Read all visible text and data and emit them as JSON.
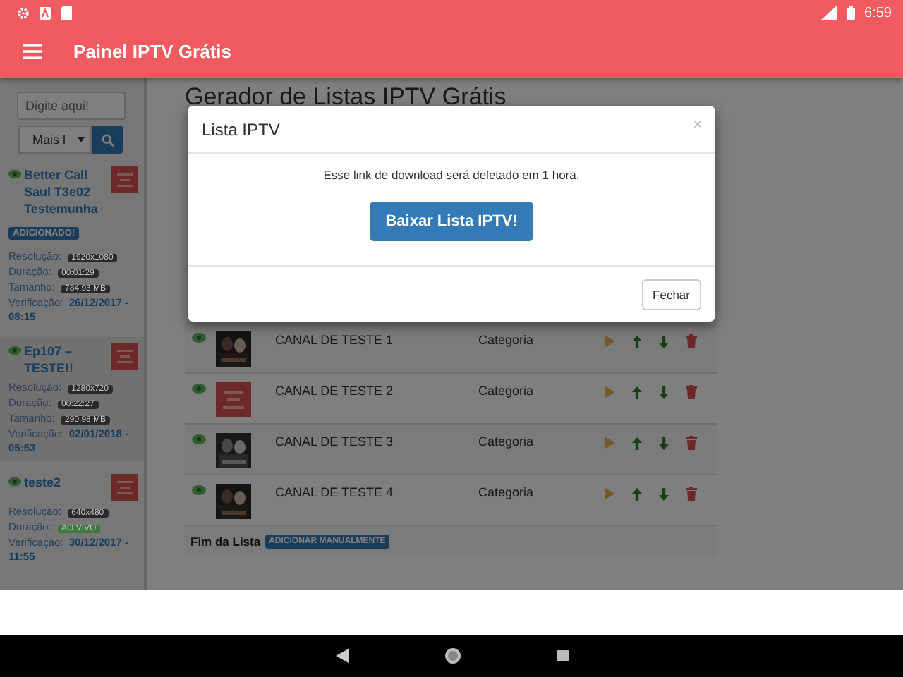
{
  "status_bar": {
    "time": "6:59"
  },
  "app_bar": {
    "title": "Painel IPTV Grátis"
  },
  "sidebar": {
    "search": {
      "placeholder": "Digite aqui!"
    },
    "filter": {
      "value": "Mais l"
    },
    "items": [
      {
        "title": "Better Call Saul T3e02 Testemunha",
        "status_badge": "ADICIONADO!",
        "fields": [
          {
            "label": "Resolução:",
            "value": "1920x1080",
            "kind": "badge",
            "color": "#2a2a2a"
          },
          {
            "label": "Duração:",
            "value": "00:01:29",
            "kind": "badge",
            "color": "#2a2a2a"
          },
          {
            "label": "Tamanho:",
            "value": "784,93 MB",
            "kind": "badge",
            "color": "#2a2a2a"
          },
          {
            "label": "Verificação:",
            "value": "26/12/2017 - 08:15",
            "kind": "text"
          }
        ]
      },
      {
        "title": "Ep107 – TESTE!!",
        "fields": [
          {
            "label": "Resolução:",
            "value": "1280x720",
            "kind": "badge",
            "color": "#2a2a2a"
          },
          {
            "label": "Duração:",
            "value": "00:22:27",
            "kind": "badge",
            "color": "#2a2a2a"
          },
          {
            "label": "Tamanho:",
            "value": "290,98 MB",
            "kind": "badge",
            "color": "#2a2a2a"
          },
          {
            "label": "Verificação:",
            "value": "02/01/2018 - 05:53",
            "kind": "text"
          }
        ]
      },
      {
        "title": "teste2",
        "fields": [
          {
            "label": "Resolução:",
            "value": "640x480",
            "kind": "badge",
            "color": "#2a2a2a"
          },
          {
            "label": "Duração:",
            "value": "AO VIVO",
            "kind": "badge",
            "color": "#3e7a3e"
          },
          {
            "label": "Verificação:",
            "value": "30/12/2017 - 11:55",
            "kind": "text"
          }
        ]
      }
    ]
  },
  "main": {
    "heading": "Gerador de Listas IPTV Grátis",
    "channels": [
      {
        "name": "CANAL DE TESTE 1",
        "category": "Categoria"
      },
      {
        "name": "CANAL DE TESTE 2",
        "category": "Categoria",
        "kind": "logo"
      },
      {
        "name": "CANAL DE TESTE 3",
        "category": "Categoria"
      },
      {
        "name": "CANAL DE TESTE 4",
        "category": "Categoria"
      }
    ],
    "footer": {
      "label": "Fim da Lista",
      "button": "ADICIONAR MANUALMENTE"
    }
  },
  "modal": {
    "title": "Lista IPTV",
    "close": "×",
    "message": "Esse link de download será deletado em 1 hora.",
    "download_button": "Baixar Lista IPTV!",
    "close_button": "Fechar"
  }
}
